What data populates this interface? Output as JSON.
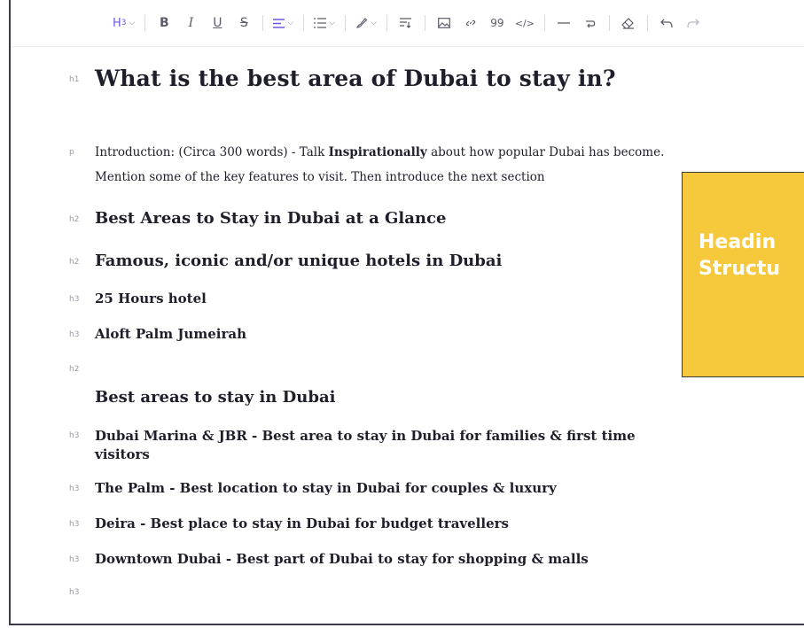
{
  "toolbar": {
    "heading_level": "H",
    "heading_sub": "3",
    "items": [
      "chevron-down",
      "bold",
      "italic",
      "underline",
      "strikethrough",
      "align",
      "list",
      "highlight",
      "insert",
      "image",
      "link",
      "quote",
      "code",
      "divider",
      "wrap",
      "clear-format",
      "undo",
      "redo"
    ],
    "labels": {
      "bold": "B",
      "italic": "I",
      "underline": "U",
      "strike": "S",
      "quote": "99",
      "code": "</>"
    }
  },
  "document": {
    "h1": {
      "tag": "h1",
      "text": "What is the best area of Dubai to stay in?"
    },
    "intro": {
      "tag": "p",
      "part1": "Introduction: (Circa 300 words) - Talk ",
      "bold": "Inspirationally",
      "part2": " about how popular Dubai has become.",
      "line2": "Mention some of the key features to visit. Then introduce the next section"
    },
    "headings": [
      {
        "tag": "h2",
        "text": "Best Areas to Stay in Dubai at a Glance"
      },
      {
        "tag": "h2",
        "text": "Famous, iconic and/or unique hotels in Dubai"
      },
      {
        "tag": "h3",
        "text": "25 Hours hotel"
      },
      {
        "tag": "h3",
        "text": "Aloft Palm Jumeirah"
      },
      {
        "tag": "h2",
        "text": ""
      },
      {
        "tag": "h2",
        "text": "Best areas to stay in Dubai"
      },
      {
        "tag": "h3",
        "text": "Dubai Marina & JBR - Best area to stay in Dubai for families & first time",
        "line2": "visitors"
      },
      {
        "tag": "h3",
        "text": "The Palm - Best location to stay in Dubai for couples & luxury"
      },
      {
        "tag": "h3",
        "text": "Deira - Best place to stay in Dubai for budget travellers"
      },
      {
        "tag": "h3",
        "text": "Downtown Dubai - Best part of Dubai to stay for shopping & malls"
      },
      {
        "tag": "h3",
        "text": ""
      }
    ]
  },
  "callout": {
    "line1": "Headin",
    "line2": "Structu",
    "color": "#f5c93b"
  },
  "colors": {
    "accent": "#6a5ae0",
    "text": "#1f1f2b",
    "tag": "#9a9aa8"
  }
}
